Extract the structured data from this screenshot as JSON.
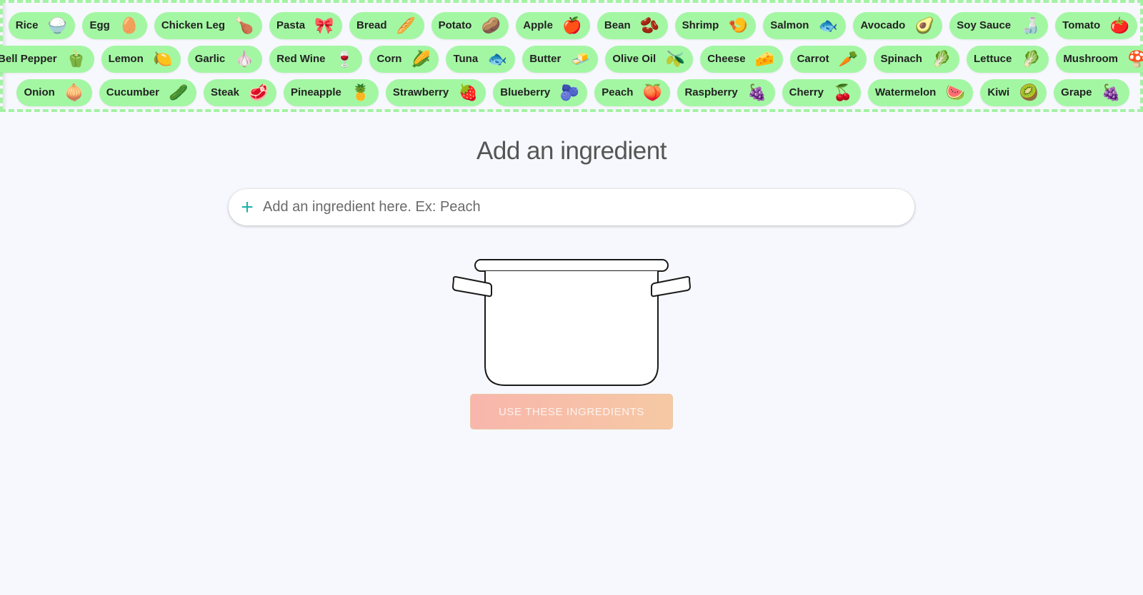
{
  "ingredient_rows": [
    [
      {
        "label": "Rice",
        "icon": "rice-bowl-icon",
        "glyph": "🍚"
      },
      {
        "label": "Egg",
        "icon": "egg-icon",
        "glyph": "🥚"
      },
      {
        "label": "Chicken Leg",
        "icon": "chicken-leg-icon",
        "glyph": "🍗"
      },
      {
        "label": "Pasta",
        "icon": "pasta-icon",
        "glyph": "🎀"
      },
      {
        "label": "Bread",
        "icon": "bread-icon",
        "glyph": "🥖"
      },
      {
        "label": "Potato",
        "icon": "potato-icon",
        "glyph": "🥔"
      },
      {
        "label": "Apple",
        "icon": "apple-icon",
        "glyph": "🍎"
      },
      {
        "label": "Bean",
        "icon": "bean-icon",
        "glyph": "🫘"
      },
      {
        "label": "Shrimp",
        "icon": "shrimp-icon",
        "glyph": "🍤"
      },
      {
        "label": "Salmon",
        "icon": "salmon-icon",
        "glyph": "🐟"
      },
      {
        "label": "Avocado",
        "icon": "avocado-icon",
        "glyph": "🥑"
      },
      {
        "label": "Soy Sauce",
        "icon": "soy-sauce-icon",
        "glyph": "🍶"
      },
      {
        "label": "Tomato",
        "icon": "tomato-icon",
        "glyph": "🍅"
      }
    ],
    [
      {
        "label": "Bell Pepper",
        "icon": "bell-pepper-icon",
        "glyph": "🫑"
      },
      {
        "label": "Lemon",
        "icon": "lemon-icon",
        "glyph": "🍋"
      },
      {
        "label": "Garlic",
        "icon": "garlic-icon",
        "glyph": "🧄"
      },
      {
        "label": "Red Wine",
        "icon": "wine-bottle-icon",
        "glyph": "🍷"
      },
      {
        "label": "Corn",
        "icon": "corn-icon",
        "glyph": "🌽"
      },
      {
        "label": "Tuna",
        "icon": "fish-icon",
        "glyph": "🐟"
      },
      {
        "label": "Butter",
        "icon": "butter-icon",
        "glyph": "🧈"
      },
      {
        "label": "Olive Oil",
        "icon": "olive-oil-icon",
        "glyph": "🫒"
      },
      {
        "label": "Cheese",
        "icon": "cheese-icon",
        "glyph": "🧀"
      },
      {
        "label": "Carrot",
        "icon": "carrot-icon",
        "glyph": "🥕"
      },
      {
        "label": "Spinach",
        "icon": "spinach-icon",
        "glyph": "🥬"
      },
      {
        "label": "Lettuce",
        "icon": "lettuce-icon",
        "glyph": "🥬"
      },
      {
        "label": "Mushroom",
        "icon": "mushroom-icon",
        "glyph": "🍄"
      }
    ],
    [
      {
        "label": "Onion",
        "icon": "onion-icon",
        "glyph": "🧅"
      },
      {
        "label": "Cucumber",
        "icon": "cucumber-icon",
        "glyph": "🥒"
      },
      {
        "label": "Steak",
        "icon": "steak-icon",
        "glyph": "🥩"
      },
      {
        "label": "Pineapple",
        "icon": "pineapple-icon",
        "glyph": "🍍"
      },
      {
        "label": "Strawberry",
        "icon": "strawberry-icon",
        "glyph": "🍓"
      },
      {
        "label": "Blueberry",
        "icon": "blueberry-icon",
        "glyph": "🫐"
      },
      {
        "label": "Peach",
        "icon": "peach-icon",
        "glyph": "🍑"
      },
      {
        "label": "Raspberry",
        "icon": "raspberry-icon",
        "glyph": "🍇"
      },
      {
        "label": "Cherry",
        "icon": "cherry-icon",
        "glyph": "🍒"
      },
      {
        "label": "Watermelon",
        "icon": "watermelon-icon",
        "glyph": "🍉"
      },
      {
        "label": "Kiwi",
        "icon": "kiwi-icon",
        "glyph": "🥝"
      },
      {
        "label": "Grape",
        "icon": "grape-icon",
        "glyph": "🍇"
      }
    ]
  ],
  "main": {
    "heading": "Add an ingredient",
    "input_placeholder": "Add an ingredient here. Ex: Peach",
    "input_value": "",
    "add_icon_glyph": "+",
    "submit_label": "USE THESE INGREDIENTS"
  },
  "colors": {
    "chip_bg": "#a3f7a3",
    "border_dash": "#a3f2a3",
    "plus_accent": "#20b2aa",
    "button_gradient_start": "#f8b6ac",
    "button_gradient_end": "#f6c9a4"
  }
}
